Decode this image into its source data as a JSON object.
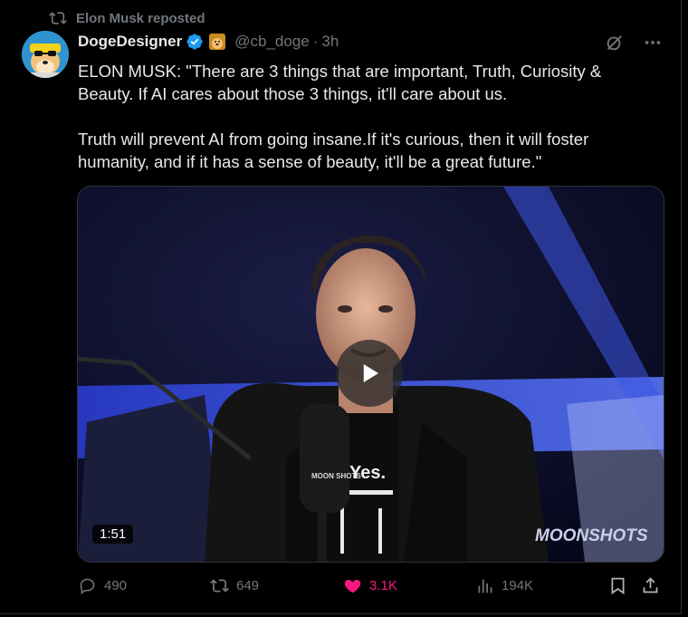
{
  "repost": {
    "label": "Elon Musk reposted",
    "icon": "repost-icon"
  },
  "author": {
    "name": "DogeDesigner",
    "handle": "@cb_doge",
    "separator": "·",
    "time": "3h",
    "verified_color": "#1d9bf0"
  },
  "tweet": {
    "paragraphs": [
      "ELON MUSK: \"There are 3 things that are important, Truth, Curiosity & Beauty. If AI cares about those 3 things, it'll care about us.",
      "Truth will prevent AI from going insane.If it's curious, then it will foster humanity, and if it has a sense of beauty, it'll be a great future.\""
    ]
  },
  "video": {
    "duration": "1:51",
    "watermark": "MOONSHOTS",
    "shirt_text": "Yes.",
    "mic_text": "MOON SHOTS"
  },
  "actions": {
    "replies": "490",
    "reposts": "649",
    "likes": "3.1K",
    "views": "194K",
    "like_color": "#f91880"
  }
}
